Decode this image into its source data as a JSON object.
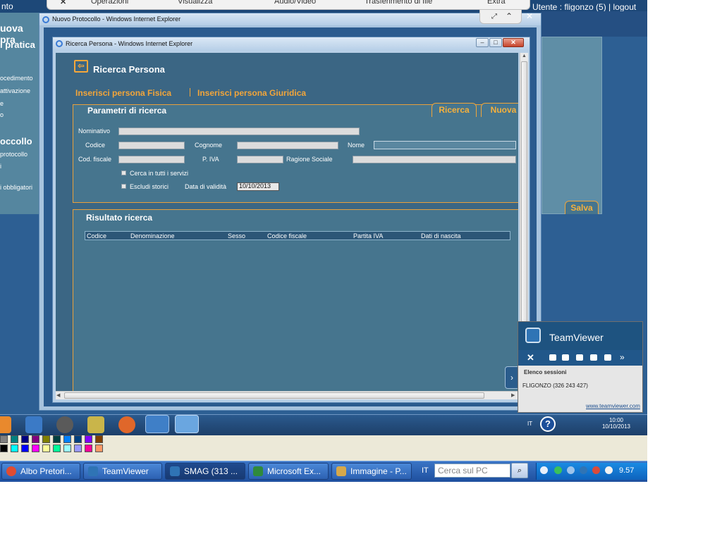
{
  "background_app": {
    "top_left_text": "nto",
    "user_info": "Utente : fligonzo (5) |  logout",
    "left_menu": [
      "uova pra",
      "i pratica",
      "ocedimento",
      "attivazione",
      "e",
      "o",
      "occollo",
      "protocollo",
      "i",
      "i obbligatori"
    ],
    "salva_label": "Salva"
  },
  "ie_toolbar": {
    "items": [
      "Operazioni",
      "Visualizza",
      "Audio/Video",
      "Trasferimento di file",
      "Extra"
    ]
  },
  "outer_window": {
    "title": "Nuovo Protocollo - Windows Internet Explorer"
  },
  "inner_window": {
    "title": "Ricerca Persona - Windows Internet Explorer",
    "header_title": "Ricerca Persona",
    "link_fisica": "Inserisci persona Fisica",
    "link_giuridica": "Inserisci persona Giuridica",
    "params": {
      "title": "Parametri di ricerca",
      "tab_ricerca": "Ricerca",
      "tab_nuova": "Nuova",
      "nominativo_label": "Nominativo",
      "nominativo_value": "",
      "codice_label": "Codice",
      "codice_value": "",
      "cognome_label": "Cognome",
      "cognome_value": "",
      "nome_label": "Nome",
      "nome_value": "",
      "codfiscale_label": "Cod. fiscale",
      "codfiscale_value": "",
      "piva_label": "P. IVA",
      "piva_value": "",
      "ragione_label": "Ragione Sociale",
      "ragione_value": "",
      "cerca_tutti_label": "Cerca in tutti i servizi",
      "escludi_label": "Escludi storici",
      "data_label": "Data di validità",
      "data_value": "10/10/2013"
    },
    "results": {
      "title": "Risultato ricerca",
      "columns": [
        "Codice",
        "Denominazione",
        "Sesso",
        "Codice fiscale",
        "Partita IVA",
        "Dati di nascita"
      ]
    }
  },
  "teamviewer": {
    "name": "TeamViewer",
    "sessions_label": "Elenco sessioni",
    "session_entry": "FLIGONZO (326 243 427)",
    "link": "www.teamviewer.com"
  },
  "remote_taskbar": {
    "lang": "IT",
    "time": "10:00",
    "date": "10/10/2013"
  },
  "palette": [
    "#000000",
    "#00ffff",
    "#0000ff",
    "#ff00ff",
    "#ffff99",
    "#00ff99",
    "#99ffff",
    "#9999ff",
    "#ff0099",
    "#ff9966",
    "#808080",
    "#008080",
    "#000080",
    "#800080",
    "#808000",
    "#004040",
    "#0080ff",
    "#004080",
    "#8000ff",
    "#804000"
  ],
  "taskbar": {
    "buttons": [
      "Albo Pretori...",
      "TeamViewer",
      "SMAG (313 ...",
      "Microsoft Ex...",
      "Immagine - P..."
    ],
    "lang": "IT",
    "search_placeholder": "Cerca sul PC",
    "time": "9.57"
  }
}
